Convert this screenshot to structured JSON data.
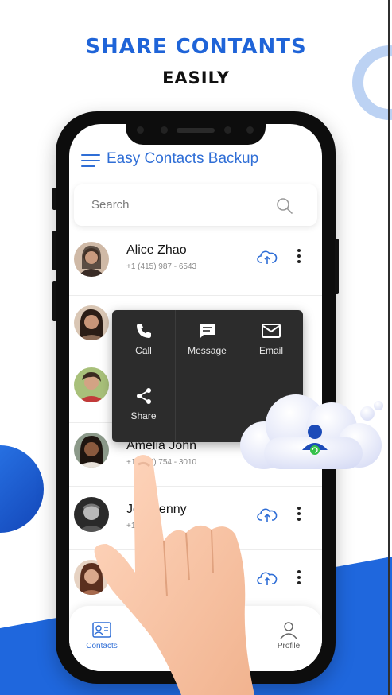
{
  "headline": {
    "line1": "SHARE CONTANTS",
    "line2": "EASILY"
  },
  "app": {
    "title": "Easy Contacts Backup",
    "search_placeholder": "Search"
  },
  "contacts": [
    {
      "name": "Alice Zhao",
      "phone": "+1 (415) 987 - 6543",
      "avatar_color": "#7a5a48"
    },
    {
      "name": "",
      "phone": "",
      "avatar_color": "#6a4a3a"
    },
    {
      "name": "",
      "phone": "",
      "avatar_color": "#8a6a56"
    },
    {
      "name": "Amelia John",
      "phone": "+1 (415) 754 - 3010",
      "avatar_color": "#6b4a36"
    },
    {
      "name": "Joe Kenny",
      "phone": "+1 (2",
      "avatar_color": "#4a4a4a"
    },
    {
      "name": "",
      "phone": "",
      "avatar_color": "#8a5b47"
    }
  ],
  "popup": {
    "call": "Call",
    "message": "Message",
    "email": "Email",
    "share": "Share"
  },
  "nav": {
    "contacts": "Contacts",
    "restore": "Re",
    "contact2": "ct",
    "profile": "Profile"
  },
  "colors": {
    "accent": "#1f64d8",
    "app_blue": "#2f6ed6",
    "popup_bg": "#2c2c2c"
  }
}
